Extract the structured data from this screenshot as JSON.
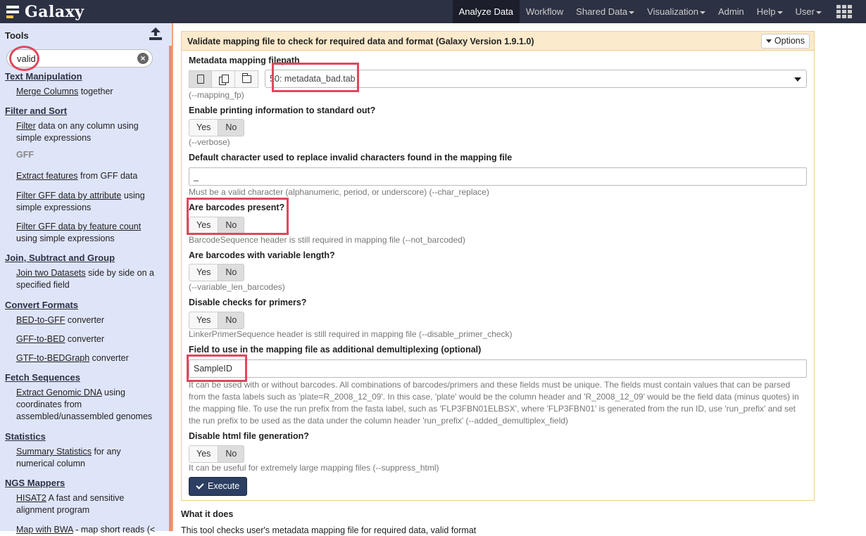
{
  "brand": {
    "name": "Galaxy"
  },
  "nav": {
    "items": [
      {
        "label": "Analyze Data",
        "active": true,
        "dropdown": false
      },
      {
        "label": "Workflow",
        "active": false,
        "dropdown": false
      },
      {
        "label": "Shared Data",
        "active": false,
        "dropdown": true
      },
      {
        "label": "Visualization",
        "active": false,
        "dropdown": true
      },
      {
        "label": "Admin",
        "active": false,
        "dropdown": false
      },
      {
        "label": "Help",
        "active": false,
        "dropdown": true
      },
      {
        "label": "User",
        "active": false,
        "dropdown": true
      }
    ],
    "apps_icon": "grid-icon"
  },
  "tools": {
    "title": "Tools",
    "upload_icon": "upload-icon",
    "search": {
      "value": "valid",
      "clear_icon": "clear-icon"
    },
    "sections": {
      "text_manipulation": "Text Manipulation",
      "filter_and_sort": "Filter and Sort",
      "join": "Join, Subtract and Group",
      "convert": "Convert Formats",
      "fetch": "Fetch Sequences",
      "statistics": "Statistics",
      "ngs": "NGS Mappers"
    },
    "items": {
      "merge_link": "Merge Columns",
      "merge_desc": " together",
      "filter_link": "Filter",
      "filter_desc": " data on any column using simple expressions",
      "gff_label": "GFF",
      "extract_link": "Extract features",
      "extract_desc": " from GFF data",
      "fga_link": "Filter GFF data by attribute",
      "fga_desc": " using simple expressions",
      "fgf_link": "Filter GFF data by feature count",
      "fgf_desc": " using simple expressions",
      "join_link": "Join two Datasets",
      "join_desc": " side by side on a specified field",
      "bed2gff_link": "BED-to-GFF",
      "bed2gff_desc": " converter",
      "gff2bed_link": "GFF-to-BED",
      "gff2bed_desc": " converter",
      "gtf2bg_link": "GTF-to-BEDGraph",
      "gtf2bg_desc": " converter",
      "egd_link": "Extract Genomic DNA",
      "egd_desc": " using coordinates from assembled/unassembled genomes",
      "sum_link": "Summary Statistics",
      "sum_desc": " for any numerical column",
      "hisat_link": "HISAT2",
      "hisat_desc": " A fast and sensitive alignment program",
      "bwa_link": "Map with BWA",
      "bwa_desc": " - map short reads (<"
    }
  },
  "form": {
    "title": "Validate mapping file to check for required data and format (Galaxy Version 1.9.1.0)",
    "options_label": "Options",
    "mapping": {
      "label": "Metadata mapping filepath",
      "value": "50: metadata_bad.tab",
      "help": "(--mapping_fp)"
    },
    "verbose": {
      "label": "Enable printing information to standard out?",
      "yes": "Yes",
      "no": "No",
      "help": "(--verbose)"
    },
    "char_replace": {
      "label": "Default character used to replace invalid characters found in the mapping file",
      "value": "_",
      "help": "Must be a valid character (alphanumeric, period, or underscore) (--char_replace)"
    },
    "barcodes": {
      "label": "Are barcodes present?",
      "yes": "Yes",
      "no": "No",
      "help": "BarcodeSequence header is still required in mapping file (--not_barcoded)"
    },
    "variable_len": {
      "label": "Are barcodes with variable length?",
      "yes": "Yes",
      "no": "No",
      "help": "(--variable_len_barcodes)"
    },
    "primers": {
      "label": "Disable checks for primers?",
      "yes": "Yes",
      "no": "No",
      "help": "LinkerPrimerSequence header is still required in mapping file (--disable_primer_check)"
    },
    "demux": {
      "label": "Field to use in the mapping file as additional demultiplexing (optional)",
      "value": "SampleID",
      "help": "It can be used with or without barcodes. All combinations of barcodes/primers and these fields must be unique. The fields must contain values that can be parsed from the fasta labels such as 'plate=R_2008_12_09'. In this case, 'plate' would be the column header and 'R_2008_12_09' would be the field data (minus quotes) in the mapping file. To use the run prefix from the fasta label, such as 'FLP3FBN01ELBSX', where 'FLP3FBN01' is generated from the run ID, use 'run_prefix' and set the run prefix to be used as the data under the column header 'run_prefix' (--added_demultiplex_field)"
    },
    "html": {
      "label": "Disable html file generation?",
      "yes": "Yes",
      "no": "No",
      "help": "It can be useful for extremely large mapping files (--suppress_html)"
    },
    "execute_label": "Execute"
  },
  "what_it_does": {
    "title": "What it does",
    "text": "This tool checks user's metadata mapping file for required data, valid format"
  },
  "colors": {
    "navbar": "#2c3143",
    "highlight": "#e0475c",
    "form_header": "#fbeacb",
    "execute": "#2c3e62"
  }
}
